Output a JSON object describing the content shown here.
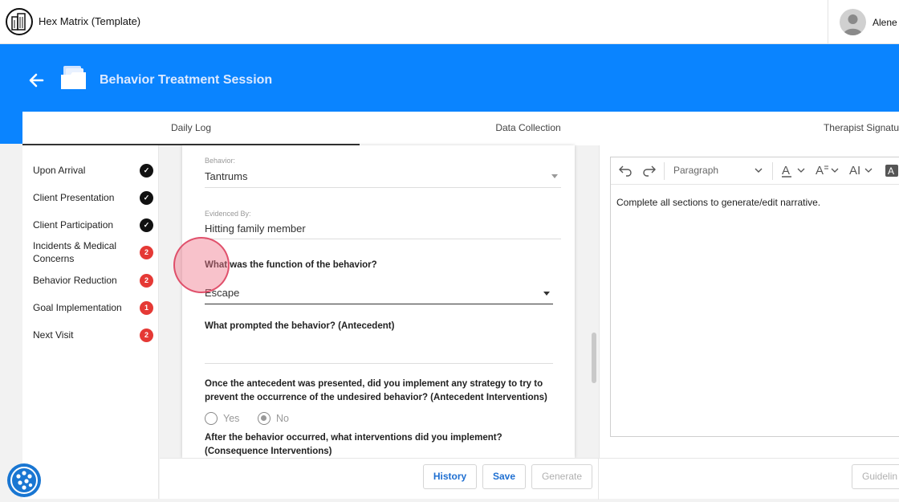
{
  "app": {
    "title": "Hex Matrix (Template)"
  },
  "user": {
    "name": "Alene"
  },
  "header": {
    "title": "Behavior Treatment Session"
  },
  "tabs": [
    {
      "label": "Daily Log",
      "active": true
    },
    {
      "label": "Data Collection",
      "active": false
    },
    {
      "label": "Therapist Signatu",
      "active": false
    }
  ],
  "sidebar": {
    "items": [
      {
        "label": "Upon Arrival",
        "status": "complete",
        "badge": "✓"
      },
      {
        "label": "Client Presentation",
        "status": "complete",
        "badge": "✓"
      },
      {
        "label": "Client Participation",
        "status": "complete",
        "badge": "✓"
      },
      {
        "label": "Incidents & Medical Concerns",
        "status": "pending",
        "badge": "2"
      },
      {
        "label": "Behavior Reduction",
        "status": "pending",
        "badge": "2"
      },
      {
        "label": "Goal Implementation",
        "status": "pending",
        "badge": "1"
      },
      {
        "label": "Next Visit",
        "status": "pending",
        "badge": "2"
      }
    ]
  },
  "form": {
    "behavior": {
      "caption": "Behavior:",
      "value": "Tantrums"
    },
    "evidenced": {
      "caption": "Evidenced By:",
      "value": "Hitting family member"
    },
    "function_q": {
      "label": "What was the function of the behavior?",
      "value": "Escape"
    },
    "antecedent_q": {
      "label": "What prompted the behavior? (Antecedent)",
      "value": ""
    },
    "antecedent_interventions_q": {
      "label": "Once the antecedent was presented, did you implement any strategy to try to prevent the occurrence of the undesired behavior? (Antecedent Interventions)",
      "options": [
        "Yes",
        "No"
      ],
      "selected": "No"
    },
    "consequence_q": {
      "label": "After the behavior occurred, what interventions did you implement? (Consequence Interventions)"
    }
  },
  "editor": {
    "style_select": "Paragraph",
    "placeholder_text": "Complete all sections to generate/edit narrative.",
    "toolbar_icons": [
      "undo-icon",
      "redo-icon",
      "font-color-icon",
      "font-size-icon",
      "text-case-icon",
      "highlight-icon"
    ]
  },
  "actions": {
    "history": "History",
    "save": "Save",
    "generate": "Generate",
    "guidelines": "Guidelin"
  },
  "colors": {
    "header_bg": "#0a84ff",
    "badge_red": "#e53935",
    "accent": "#1f6fd1"
  }
}
